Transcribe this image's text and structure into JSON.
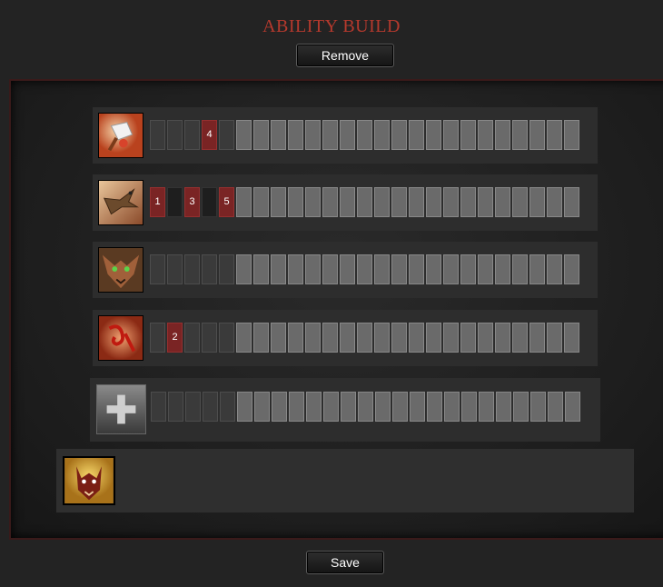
{
  "header": {
    "title": "ABILITY BUILD"
  },
  "buttons": {
    "remove": "Remove",
    "save": "Save"
  },
  "abilities": [
    {
      "icon": "cleaver-ability-icon",
      "slots": [
        "",
        "",
        "",
        "4",
        "",
        "",
        "",
        "",
        "",
        "",
        "",
        "",
        "",
        "",
        "",
        "",
        "",
        "",
        "",
        "",
        "",
        "",
        "",
        "",
        ""
      ]
    },
    {
      "icon": "bird-ability-icon",
      "slots": [
        "1",
        "",
        "3",
        "",
        "5",
        "",
        "",
        "",
        "",
        "",
        "",
        "",
        "",
        "",
        "",
        "",
        "",
        "",
        "",
        "",
        "",
        "",
        "",
        "",
        ""
      ]
    },
    {
      "icon": "beast-face-ability-icon",
      "slots": [
        "",
        "",
        "",
        "",
        "",
        "",
        "",
        "",
        "",
        "",
        "",
        "",
        "",
        "",
        "",
        "",
        "",
        "",
        "",
        "",
        "",
        "",
        "",
        "",
        ""
      ]
    },
    {
      "icon": "blood-rune-ability-icon",
      "slots": [
        "",
        "2",
        "",
        "",
        "",
        "",
        "",
        "",
        "",
        "",
        "",
        "",
        "",
        "",
        "",
        "",
        "",
        "",
        "",
        "",
        "",
        "",
        "",
        "",
        ""
      ]
    },
    {
      "icon": "add-ability-icon",
      "slots": [
        "",
        "",
        "",
        "",
        "",
        "",
        "",
        "",
        "",
        "",
        "",
        "",
        "",
        "",
        "",
        "",
        "",
        "",
        "",
        "",
        "",
        "",
        "",
        "",
        ""
      ]
    }
  ],
  "hero": {
    "icon": "hero-portrait-icon"
  },
  "colors": {
    "title": "#b5392d",
    "active_slot": "#7a2424",
    "panel_border": "#3a1a1a"
  }
}
